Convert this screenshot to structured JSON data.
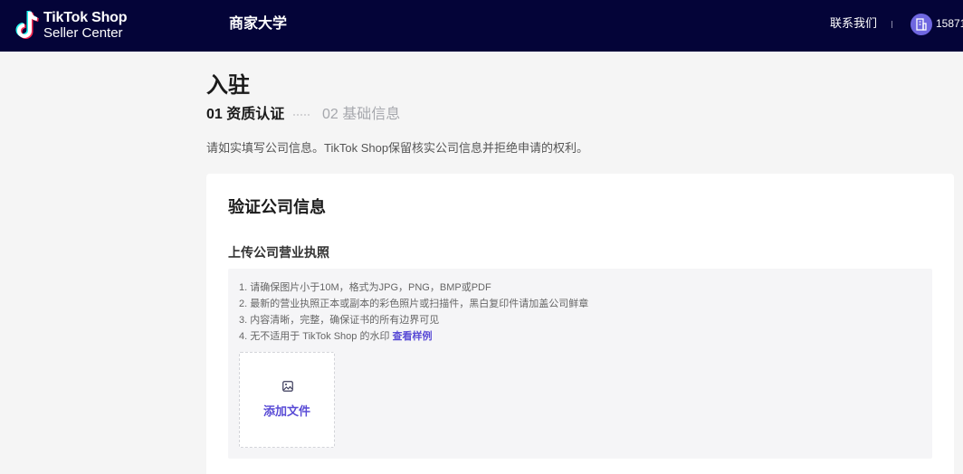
{
  "header": {
    "logo_line1": "TikTok Shop",
    "logo_line2": "Seller Center",
    "nav_title": "商家大学",
    "contact": "联系我们",
    "account": "15871"
  },
  "page": {
    "title": "入驻",
    "steps": [
      {
        "label": "01 资质认证",
        "active": true
      },
      {
        "label": "02 基础信息",
        "active": false
      }
    ],
    "notice": "请如实填写公司信息。TikTok Shop保留核实公司信息并拒绝申请的权利。"
  },
  "card": {
    "title": "验证公司信息",
    "field_label": "上传公司营业执照",
    "tips": [
      "1. 请确保图片小于10M，格式为JPG，PNG，BMP或PDF",
      "2. 最新的营业执照正本或副本的彩色照片或扫描件，黑白复印件请加盖公司鲜章",
      "3. 内容清晰，完整，确保证书的所有边界可见",
      "4. 无不适用于 TikTok Shop 的水印"
    ],
    "sample_link": "查看样例",
    "upload_label": "添加文件",
    "upload_icon": "image-icon"
  },
  "colors": {
    "header_bg": "#040438",
    "accent": "#5a4cd6",
    "page_bg": "#f5f5f5"
  }
}
